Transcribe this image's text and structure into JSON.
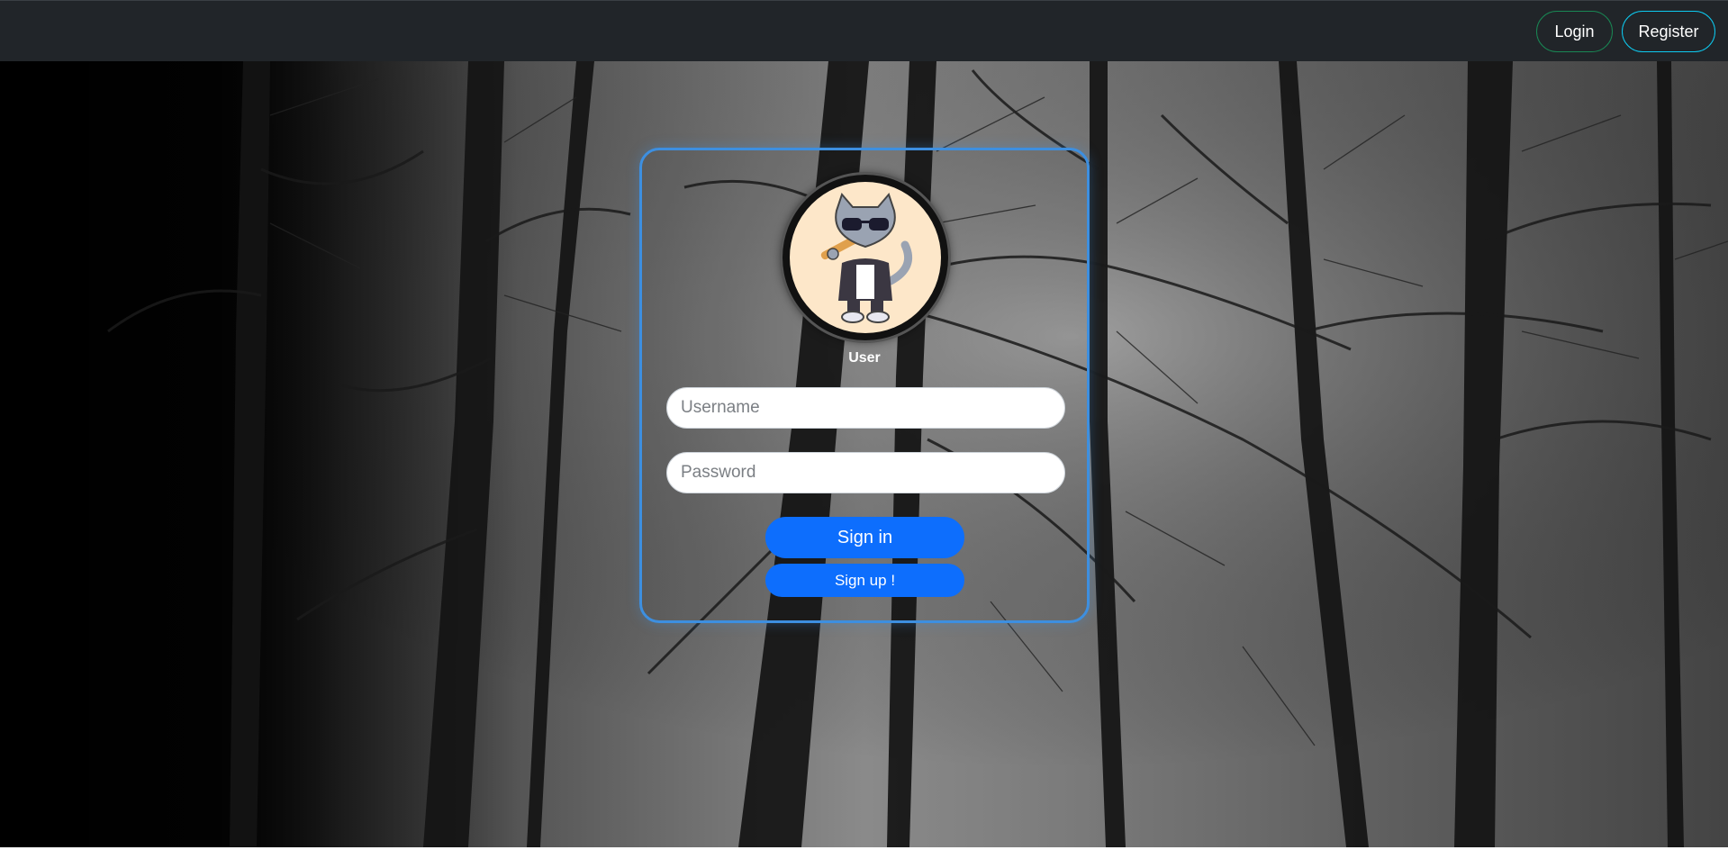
{
  "navbar": {
    "login_label": "Login",
    "register_label": "Register"
  },
  "card": {
    "avatar_label": "User",
    "username_placeholder": "Username",
    "password_placeholder": "Password",
    "signin_label": "Sign in",
    "signup_label": "Sign up !"
  },
  "colors": {
    "navbar_bg": "#212529",
    "primary": "#0d6efd",
    "card_border": "#3d8fe0",
    "login_border": "#198754",
    "register_border": "#0dcaf0"
  },
  "icons": {
    "avatar": "cat-with-sunglasses-and-bat-avatar"
  }
}
